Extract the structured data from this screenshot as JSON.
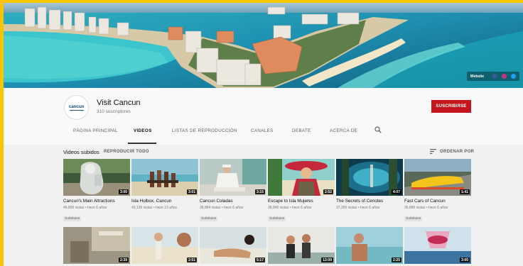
{
  "banner": {
    "website_label": "Website",
    "social_colors": [
      "#3b5998",
      "#c13584",
      "#1da1f2"
    ]
  },
  "channel": {
    "logo_text": "cancun",
    "name": "Visit Cancun",
    "subscribers": "310 suscriptores",
    "subscribe_label": "SUSCRIBIRSE"
  },
  "tabs": [
    "PÁGINA PRINCIPAL",
    "VIDEOS",
    "LISTAS DE REPRODUCCIÓN",
    "CANALES",
    "DEBATE",
    "ACERCA DE"
  ],
  "active_tab": "VIDEOS",
  "section": {
    "title": "Videos subidos",
    "play_all": "REPRODUCIR TODO",
    "sort_label": "ORDENAR POR"
  },
  "videos_row1": [
    {
      "title": "Cancun's Main Attractions",
      "meta": "46,836 vistas • hace 6 años",
      "duration": "3:00",
      "badge": "Subtítulos"
    },
    {
      "title": "Isla Holbox, Cancun",
      "meta": "43,126 vistas • hace 13 años",
      "duration": "3:01",
      "badge": ""
    },
    {
      "title": "Cancun Coladas",
      "meta": "38,864 vistas • hace 6 años",
      "duration": "3:15",
      "badge": "Subtítulos"
    },
    {
      "title": "Escape to Isla Mujeres",
      "meta": "38,845 vistas • hace 6 años",
      "duration": "2:52",
      "badge": "Subtítulos"
    },
    {
      "title": "The Secrets of Cenotes",
      "meta": "37,265 vistas • hace 6 años",
      "duration": "4:07",
      "badge": ""
    },
    {
      "title": "Fast Cars of Cancun",
      "meta": "36,886 vistas • hace 6 años",
      "duration": "1:41",
      "badge": "Subtítulos"
    }
  ],
  "videos_row2": [
    {
      "duration": "2:39"
    },
    {
      "duration": "2:51"
    },
    {
      "duration": "5:17"
    },
    {
      "duration": "13:09"
    },
    {
      "duration": "2:25"
    },
    {
      "duration": "3:00"
    }
  ]
}
